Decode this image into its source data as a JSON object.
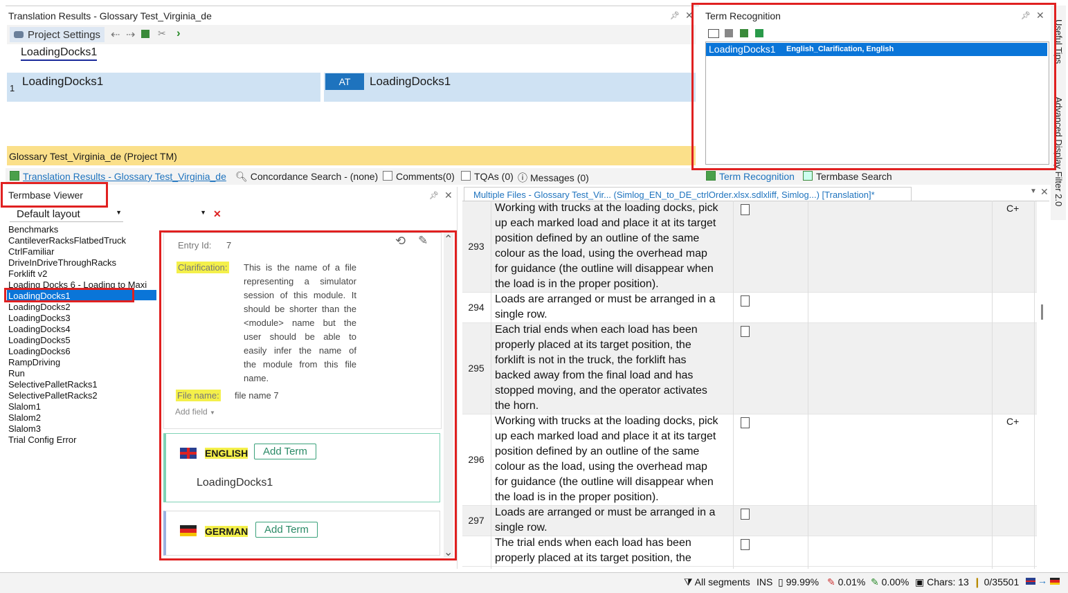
{
  "translation_results": {
    "title": "Translation Results - Glossary Test_Virginia_de",
    "project_settings": "Project Settings",
    "search_term": "LoadingDocks1",
    "row_number": "1",
    "source": "LoadingDocks1",
    "badge": "AT",
    "target": "LoadingDocks1",
    "tm_name": "Glossary Test_Virginia_de (Project TM)"
  },
  "term_recognition": {
    "title": "Term Recognition",
    "result_term": "LoadingDocks1",
    "result_meta": "English_Clarification, English"
  },
  "side_tabs": [
    "Useful Tips",
    "Advanced Display Filter 2.0"
  ],
  "bottom_tabs": {
    "translation_results": "Translation Results - Glossary Test_Virginia_de",
    "concordance": "Concordance Search - (none)",
    "comments": "Comments(0)",
    "tqas": "TQAs (0)",
    "messages": "Messages (0)",
    "term_recognition": "Term Recognition",
    "termbase_search": "Termbase Search"
  },
  "termbase_viewer": {
    "title": "Termbase Viewer",
    "layout": "Default layout",
    "entries": [
      "Benchmarks",
      "CantileverRacksFlatbedTruck",
      "CtrlFamiliar",
      "DriveInDriveThroughRacks",
      "Forklift v2",
      "Loading Docks 6 - Loading to Maxi",
      "LoadingDocks1",
      "LoadingDocks2",
      "LoadingDocks3",
      "LoadingDocks4",
      "LoadingDocks5",
      "LoadingDocks6",
      "RampDriving",
      "Run",
      "SelectivePalletRacks1",
      "SelectivePalletRacks2",
      "Slalom1",
      "Slalom2",
      "Slalom3",
      "Trial Config Error"
    ]
  },
  "entry": {
    "id_label": "Entry Id:",
    "id_value": "7",
    "clarification_label": "Clarification:",
    "clarification_text": [
      "This is the name of a file",
      "representing a simulator",
      "session of this module. It",
      "should be shorter than the",
      "<module> name but the",
      "user should be able to",
      "easily infer the name of",
      "the module from this file",
      "name."
    ],
    "file_name_label": "File name:",
    "file_name_value": "file name 7",
    "add_field": "Add field",
    "english_label": "ENGLISH",
    "english_add": "Add Term",
    "english_term": "LoadingDocks1",
    "german_label": "GERMAN",
    "german_add": "Add Term"
  },
  "editor": {
    "title": "Multiple Files - Glossary Test_Vir... (Simlog_EN_to_DE_ctrlOrder.xlsx.sdlxliff, Simlog...) [Translation]*",
    "segments": [
      {
        "num": "293",
        "lines": [
          "Working with trucks at the loading docks, pick",
          "up each marked load and place it at its target",
          "position defined by an outline of the same",
          "colour as the load, using the overhead map",
          "for guidance (the outline will disappear when",
          "the load is in the proper position)."
        ],
        "flag": "C+"
      },
      {
        "num": "294",
        "lines": [
          "Loads are arranged or must be arranged in a",
          "single row."
        ],
        "flag": ""
      },
      {
        "num": "295",
        "lines": [
          "Each trial ends when each load has been",
          "properly placed at its target position, the",
          "forklift is not in the truck, the forklift has",
          "backed away from the final load and has",
          "stopped moving, and the operator activates",
          "the horn."
        ],
        "flag": ""
      },
      {
        "num": "296",
        "lines": [
          "Working with trucks at the loading docks, pick",
          "up each marked load and place it at its target",
          "position defined by an outline of the same",
          "colour as the load, using the overhead map",
          "for guidance (the outline will disappear when",
          "the load is in the proper position)."
        ],
        "flag": "C+"
      },
      {
        "num": "297",
        "lines": [
          "Loads are arranged or must be arranged in a",
          "single row."
        ],
        "flag": ""
      },
      {
        "num": "",
        "lines": [
          "The trial ends when each load has been",
          "properly placed at its target position, the"
        ],
        "flag": ""
      }
    ]
  },
  "status": {
    "filter": "All segments",
    "mode": "INS",
    "pct1": "99.99%",
    "pct2": "0.01%",
    "pct3": "0.00%",
    "chars": "Chars: 13",
    "count": "0/35501"
  }
}
